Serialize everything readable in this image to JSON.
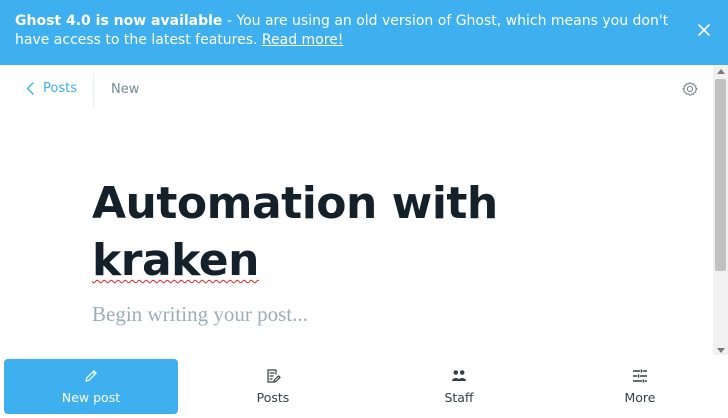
{
  "banner": {
    "bold": "Ghost 4.0 is now available",
    "text": " - You are using an old version of Ghost, which means you don't have access to the latest features. ",
    "link": "Read more!",
    "close_icon": "close-icon"
  },
  "header": {
    "back_label": "Posts",
    "status": "New",
    "settings_icon": "gear-icon"
  },
  "editor": {
    "title_line1": "Automation with",
    "title_line2": "kraken",
    "body_placeholder": "Begin writing your post..."
  },
  "tabbar": {
    "tabs": [
      {
        "label": "New post",
        "icon": "pencil-icon",
        "active": true
      },
      {
        "label": "Posts",
        "icon": "edit-document-icon",
        "active": false
      },
      {
        "label": "Staff",
        "icon": "people-icon",
        "active": false
      },
      {
        "label": "More",
        "icon": "menu-sliders-icon",
        "active": false
      }
    ]
  },
  "colors": {
    "accent": "#3eb0ef",
    "title": "#15212a",
    "placeholder": "#9baeb8",
    "muted": "#738a94"
  }
}
